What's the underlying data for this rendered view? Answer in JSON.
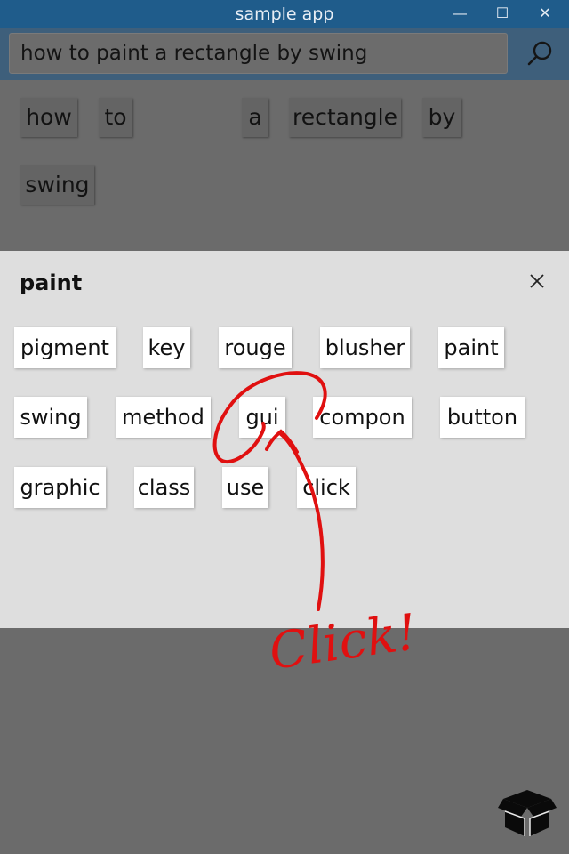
{
  "window": {
    "title": "sample app",
    "controls": [
      "—",
      "☐",
      "✕"
    ]
  },
  "search": {
    "query": "how to paint a rectangle by swing",
    "icon": "search-icon"
  },
  "query_words": [
    "how",
    "to",
    "a",
    "rectangle",
    "by",
    "swing"
  ],
  "suggestion_panel": {
    "title": "paint",
    "close_icon": "close-icon",
    "chips": [
      "pigment",
      "key",
      "rouge",
      "blusher",
      "paint",
      "swing",
      "method",
      "gui",
      "compon",
      "button",
      "graphic",
      "class",
      "use",
      "click"
    ]
  },
  "annotation": {
    "text": "Click!",
    "color": "#e01010"
  },
  "footer": {
    "icon": "box-icon"
  }
}
